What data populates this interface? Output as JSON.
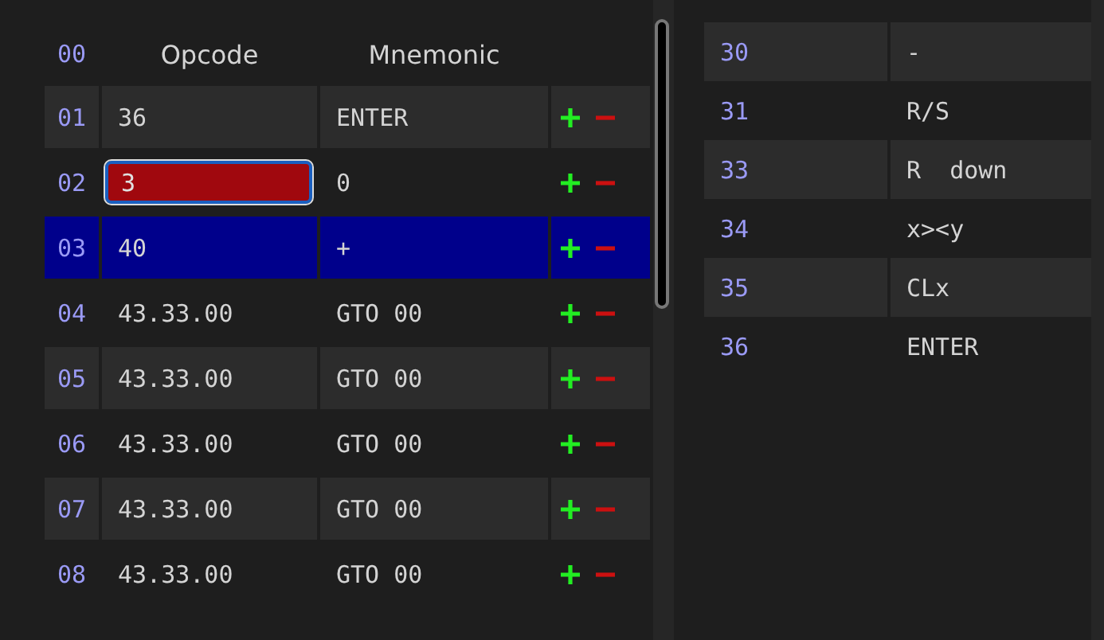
{
  "program": {
    "header": {
      "number": "00",
      "opcode_label": "Opcode",
      "mnemonic_label": "Mnemonic"
    },
    "rows": [
      {
        "number": "01",
        "kind": "text",
        "opcode": "36",
        "mnemonic": "ENTER",
        "selected": false
      },
      {
        "number": "02",
        "kind": "field",
        "opcode": "3",
        "invalid": true,
        "mnemonic": "0",
        "selected": false
      },
      {
        "number": "03",
        "kind": "text",
        "opcode": "40",
        "mnemonic": "+",
        "selected": true
      },
      {
        "number": "04",
        "kind": "text",
        "opcode": "43.33.00",
        "mnemonic": "GTO 00",
        "selected": false
      },
      {
        "number": "05",
        "kind": "text",
        "opcode": "43.33.00",
        "mnemonic": "GTO 00",
        "selected": false
      },
      {
        "number": "06",
        "kind": "text",
        "opcode": "43.33.00",
        "mnemonic": "GTO 00",
        "selected": false
      },
      {
        "number": "07",
        "kind": "text",
        "opcode": "43.33.00",
        "mnemonic": "GTO 00",
        "selected": false
      },
      {
        "number": "08",
        "kind": "text",
        "opcode": "43.33.00",
        "mnemonic": "GTO 00",
        "selected": false
      }
    ]
  },
  "reference": [
    {
      "code": "30",
      "name": "-"
    },
    {
      "code": "31",
      "name": "R/S"
    },
    {
      "code": "33",
      "name": "R  down"
    },
    {
      "code": "34",
      "name": "x><y"
    },
    {
      "code": "35",
      "name": "CLx"
    },
    {
      "code": "36",
      "name": "ENTER"
    }
  ]
}
